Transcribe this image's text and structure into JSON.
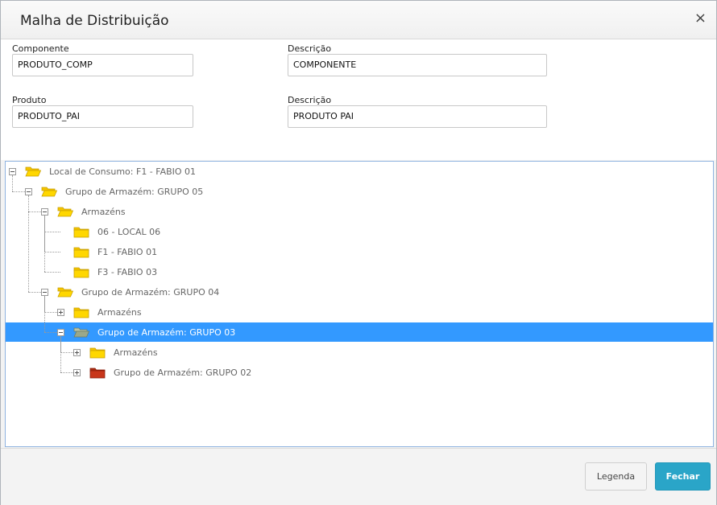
{
  "dialog": {
    "title": "Malha de Distribuição",
    "close_glyph": "×"
  },
  "form": {
    "componente_label": "Componente",
    "componente_value": "PRODUTO_COMP",
    "descricao1_label": "Descrição",
    "descricao1_value": "COMPONENTE",
    "produto_label": "Produto",
    "produto_value": "PRODUTO_PAI",
    "descricao2_label": "Descrição",
    "descricao2_value": "PRODUTO PAI"
  },
  "tree": {
    "nodes": [
      {
        "label": "Local de Consumo: F1 - FABIO 01",
        "level": 0,
        "toggle": "minus",
        "folder": "open"
      },
      {
        "label": "Grupo de Armazém: GRUPO 05",
        "level": 1,
        "toggle": "minus",
        "folder": "open"
      },
      {
        "label": "Armazéns",
        "level": 2,
        "toggle": "minus",
        "folder": "open"
      },
      {
        "label": "06 - LOCAL 06",
        "level": 3,
        "toggle": "none",
        "folder": "closed"
      },
      {
        "label": "F1 - FABIO 01",
        "level": 3,
        "toggle": "none",
        "folder": "closed"
      },
      {
        "label": "F3 - FABIO 03",
        "level": 3,
        "toggle": "none",
        "folder": "closed"
      },
      {
        "label": "Grupo de Armazém: GRUPO 04",
        "level": 2,
        "toggle": "minus",
        "folder": "open"
      },
      {
        "label": "Armazéns",
        "level": 3,
        "toggle": "plus",
        "folder": "closed"
      },
      {
        "label": "Grupo de Armazém: GRUPO 03",
        "level": 3,
        "toggle": "minus",
        "folder": "open-green",
        "selected": true
      },
      {
        "label": "Armazéns",
        "level": 4,
        "toggle": "plus",
        "folder": "closed"
      },
      {
        "label": "Grupo de Armazém: GRUPO 02",
        "level": 4,
        "toggle": "plus",
        "folder": "red"
      }
    ]
  },
  "footer": {
    "legenda_label": "Legenda",
    "fechar_label": "Fechar"
  },
  "colors": {
    "selection": "#3399ff",
    "primary_button": "#2aa5c8",
    "folder_yellow": "#ffd700",
    "folder_red": "#c8361a"
  }
}
